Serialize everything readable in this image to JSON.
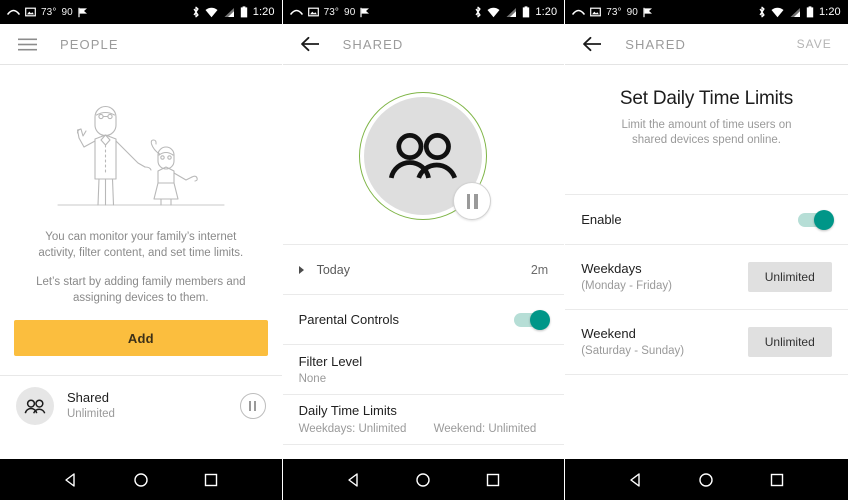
{
  "statusbar": {
    "temp": "73°",
    "count": "90",
    "time": "1:20",
    "icons": [
      "call-missed-icon",
      "image-icon",
      "flag-icon",
      "bluetooth-icon",
      "wifi-icon",
      "cellular-signal-icon",
      "battery-icon"
    ]
  },
  "navbar": {
    "back": "back-triangle-icon",
    "home": "home-circle-icon",
    "recents": "recents-square-icon"
  },
  "panel1": {
    "appbar": {
      "menu_icon": "hamburger-menu-icon",
      "title": "PEOPLE"
    },
    "illustration": "family-adult-and-child-illustration",
    "blurb_line1": "You can monitor your family’s internet activity, filter content, and set time limits.",
    "blurb_line2": "Let’s start by adding family members and assigning devices to them.",
    "add_label": "Add",
    "person": {
      "name": "Shared",
      "sub": "Unlimited",
      "avatar_icon": "people-group-icon",
      "pause_icon": "pause-icon"
    }
  },
  "panel2": {
    "appbar": {
      "back_icon": "arrow-back-icon",
      "title": "SHARED"
    },
    "avatar": {
      "icon": "people-group-icon",
      "ring_color": "#7fb547",
      "pause_icon": "pause-icon"
    },
    "rows": [
      {
        "name": "today",
        "label": "Today",
        "value": "2m"
      },
      {
        "name": "parental-controls",
        "label": "Parental Controls",
        "toggle": "on"
      },
      {
        "name": "filter-level",
        "label": "Filter Level",
        "sub": "None"
      },
      {
        "name": "daily-time-limits",
        "label": "Daily Time Limits",
        "sub_left": "Weekdays: Unlimited",
        "sub_right": "Weekend: Unlimited"
      }
    ]
  },
  "panel3": {
    "appbar": {
      "back_icon": "arrow-back-icon",
      "title": "SHARED",
      "save_label": "SAVE"
    },
    "title": "Set Daily Time Limits",
    "subtitle": "Limit the amount of time users on shared devices spend online.",
    "rows": [
      {
        "name": "enable",
        "label": "Enable",
        "toggle": "on"
      },
      {
        "name": "weekdays",
        "label": "Weekdays",
        "sub": "(Monday - Friday)",
        "chip": "Unlimited"
      },
      {
        "name": "weekend",
        "label": "Weekend",
        "sub": "(Saturday - Sunday)",
        "chip": "Unlimited"
      }
    ]
  },
  "colors": {
    "accent_amber": "#fbbe3e",
    "toggle_teal": "#009688",
    "ring_green": "#7fb547"
  }
}
